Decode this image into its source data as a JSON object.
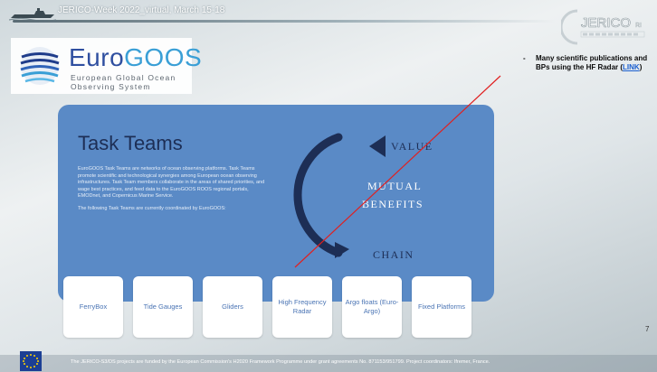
{
  "header": {
    "title": "JERICO-Week 2022_virtual, March 15-18"
  },
  "eurogoos": {
    "name_part1": "Euro",
    "name_part2": "GOOS",
    "subtitle": "European Global Ocean Observing System"
  },
  "note": {
    "text": "Many scientific publications and BPs using the HF Radar (",
    "link": "LINK",
    "close": ")"
  },
  "panel": {
    "title": "Task Teams",
    "paragraph1": "EuroGOOS Task Teams are networks of ocean observing platforms. Task Teams promote scientific and technological synergies among European ocean observing infrastructures. Task Team members collaborate in the areas of shared priorities, and wage best practices, and feed data to the EuroGOOS ROOS regional portals, EMODnet, and Copernicus Marine Service.",
    "paragraph2": "The following Task Teams are currently coordinated by EuroGOOS:",
    "cycle": {
      "top": "VALUE",
      "mid1": "MUTUAL",
      "mid2": "BENEFITS",
      "bottom": "CHAIN"
    }
  },
  "cards": [
    {
      "label": "FerryBox"
    },
    {
      "label": "Tide Gauges"
    },
    {
      "label": "Gliders"
    },
    {
      "label": "High Frequency Radar"
    },
    {
      "label": "Argo floats (Euro-Argo)"
    },
    {
      "label": "Fixed Platforms"
    }
  ],
  "page_number": "7",
  "footer": {
    "text": "The JERICO-S3/DS projects are funded by the European Commission's H2020 Framework Programme under grant agreements No. 871153/951799. Project coordinators: Ifremer, France."
  },
  "colors": {
    "panel_bg": "#5a8ac6",
    "title_dark": "#1d2e55",
    "card_text": "#4a74b4",
    "red_line": "#e02020",
    "link": "#1a5fd0"
  },
  "icons": [
    "boat-icon",
    "jerico-logo-icon",
    "eurogoos-waves-icon",
    "cycle-arrows-icon",
    "eu-flag-icon"
  ]
}
